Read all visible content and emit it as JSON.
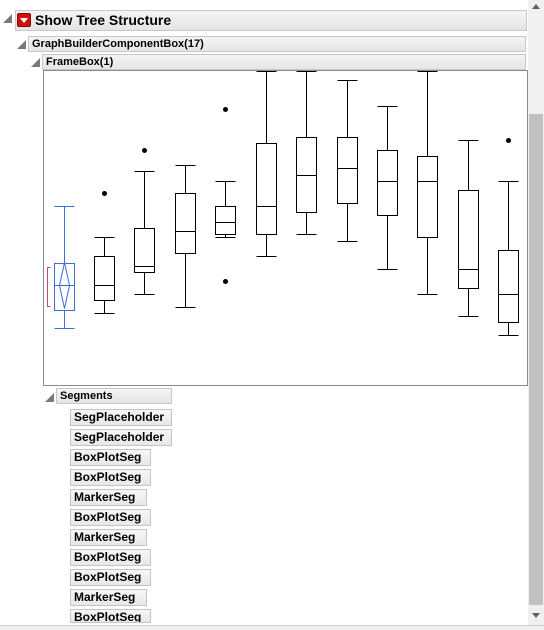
{
  "header": {
    "title": "Show Tree Structure",
    "menu_icon": "red-dropdown-triangle"
  },
  "tree": {
    "component_label": "GraphBuilderComponentBox(17)",
    "frame_label": "FrameBox(1)",
    "segments_label": "Segments",
    "segments": [
      "SegPlaceholder",
      "SegPlaceholder",
      "BoxPlotSeg",
      "BoxPlotSeg",
      "MarkerSeg",
      "BoxPlotSeg",
      "MarkerSeg",
      "BoxPlotSeg",
      "BoxPlotSeg",
      "MarkerSeg",
      "BoxPlotSeg"
    ]
  },
  "chart_data": {
    "type": "box",
    "y_scale": [
      0,
      100
    ],
    "boxes": [
      {
        "min": 18,
        "q1": 24,
        "median": 32,
        "q3": 39,
        "max": 57,
        "mean_diamond": true
      },
      {
        "min": 23,
        "q1": 27,
        "median": 32,
        "q3": 41,
        "max": 47,
        "outliers": [
          61
        ]
      },
      {
        "min": 29,
        "q1": 36,
        "median": 38,
        "q3": 50,
        "max": 68,
        "outliers": [
          75
        ]
      },
      {
        "min": 25,
        "q1": 42,
        "median": 49,
        "q3": 61,
        "max": 70
      },
      {
        "min": 47,
        "q1": 48,
        "median": 52,
        "q3": 57,
        "max": 65,
        "outliers": [
          88,
          33
        ]
      },
      {
        "min": 41,
        "q1": 48,
        "median": 57,
        "q3": 77,
        "max": 100
      },
      {
        "min": 48,
        "q1": 55,
        "median": 67,
        "q3": 79,
        "max": 100
      },
      {
        "min": 46,
        "q1": 58,
        "median": 69,
        "q3": 79,
        "max": 97
      },
      {
        "min": 37,
        "q1": 54,
        "median": 65,
        "q3": 75,
        "max": 89
      },
      {
        "min": 29,
        "q1": 47,
        "median": 65,
        "q3": 73,
        "max": 100
      },
      {
        "min": 22,
        "q1": 31,
        "median": 37,
        "q3": 62,
        "max": 78
      },
      {
        "min": 16,
        "q1": 20,
        "median": 29,
        "q3": 43,
        "max": 65,
        "outliers": [
          78
        ]
      }
    ],
    "colors": {
      "first_box": "#3c6fd6",
      "other_boxes": "#000000",
      "bracket": "#c0497a"
    }
  }
}
